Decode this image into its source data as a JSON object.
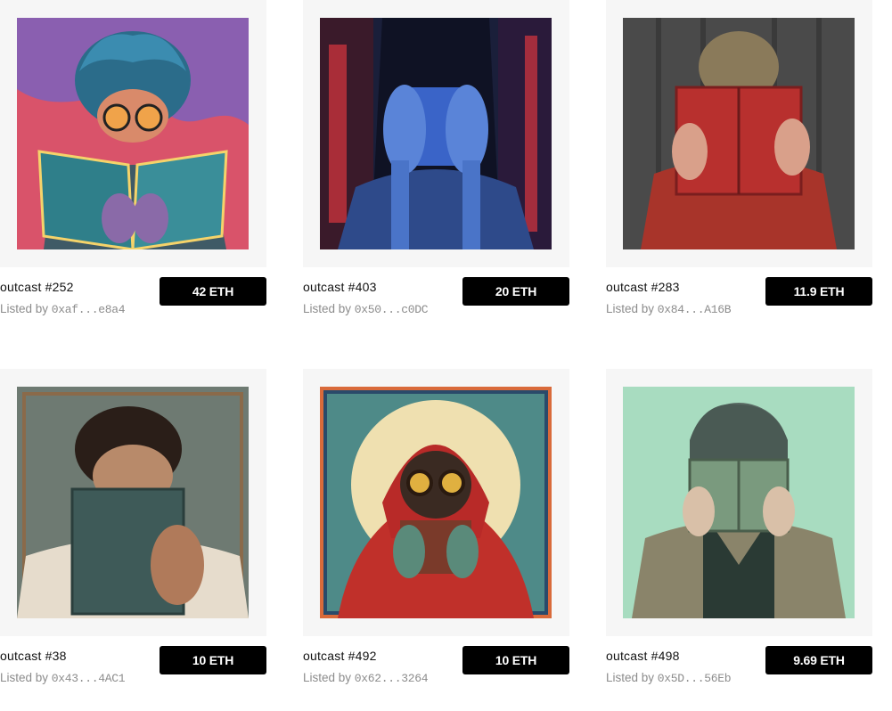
{
  "listings": [
    {
      "title": "outcast #252",
      "seller_prefix": "Listed by ",
      "seller": "0xaf...e8a4",
      "price": "42 ETH"
    },
    {
      "title": "outcast #403",
      "seller_prefix": "Listed by ",
      "seller": "0x50...c0DC",
      "price": "20 ETH"
    },
    {
      "title": "outcast #283",
      "seller_prefix": "Listed by ",
      "seller": "0x84...A16B",
      "price": "11.9 ETH"
    },
    {
      "title": "outcast #38",
      "seller_prefix": "Listed by ",
      "seller": "0x43...4AC1",
      "price": "10 ETH"
    },
    {
      "title": "outcast #492",
      "seller_prefix": "Listed by ",
      "seller": "0x62...3264",
      "price": "10 ETH"
    },
    {
      "title": "outcast #498",
      "seller_prefix": "Listed by ",
      "seller": "0x5D...56Eb",
      "price": "9.69 ETH"
    }
  ],
  "colors": {
    "card_bg": "#f6f6f6",
    "button_bg": "#000000",
    "button_text": "#ffffff",
    "secondary_text": "#8c8c8c"
  },
  "icons": [
    "nft-artwork-image"
  ]
}
